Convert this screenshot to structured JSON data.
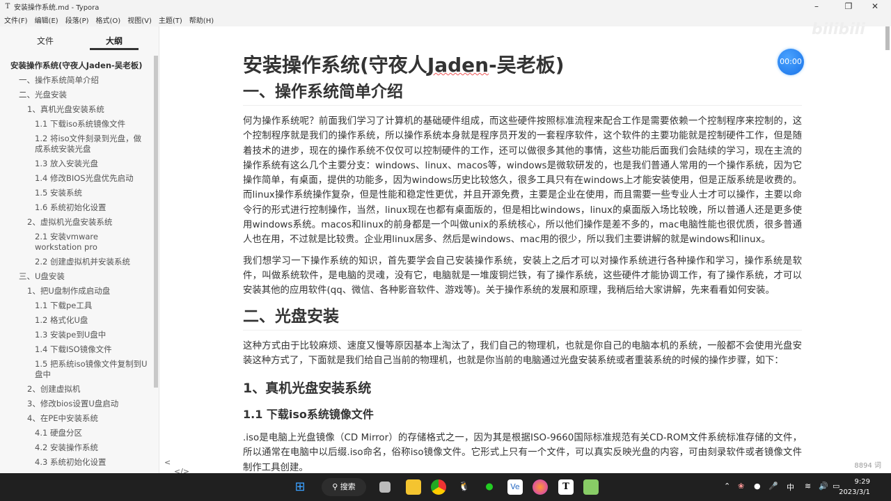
{
  "window": {
    "title": "安装操作系统.md - Typora",
    "app_icon": "T"
  },
  "menu": [
    "文件(F)",
    "编辑(E)",
    "段落(P)",
    "格式(O)",
    "视图(V)",
    "主题(T)",
    "帮助(H)"
  ],
  "sidebar": {
    "tabs": [
      "文件",
      "大纲"
    ],
    "active_tab": "大纲",
    "outline": [
      {
        "level": 0,
        "text": "安装操作系统(守夜人Jaden-吴老板)"
      },
      {
        "level": 1,
        "text": "一、操作系统简单介绍"
      },
      {
        "level": 1,
        "text": "二、光盘安装"
      },
      {
        "level": 2,
        "text": "1、真机光盘安装系统"
      },
      {
        "level": 3,
        "text": "1.1 下载iso系统镜像文件"
      },
      {
        "level": 3,
        "text": "1.2 将iso文件刻录到光盘，做成系统安装光盘"
      },
      {
        "level": 3,
        "text": "1.3 放入安装光盘"
      },
      {
        "level": 3,
        "text": "1.4 修改BIOS光盘优先启动"
      },
      {
        "level": 3,
        "text": "1.5 安装系统"
      },
      {
        "level": 3,
        "text": "1.6 系统初始化设置"
      },
      {
        "level": 2,
        "text": "2、虚拟机光盘安装系统"
      },
      {
        "level": 3,
        "text": "2.1 安装vmware workstation pro"
      },
      {
        "level": 3,
        "text": "2.2 创建虚拟机并安装系统"
      },
      {
        "level": 1,
        "text": "三、U盘安装"
      },
      {
        "level": 2,
        "text": "1、把U盘制作成启动盘"
      },
      {
        "level": 3,
        "text": "1.1 下载pe工具"
      },
      {
        "level": 3,
        "text": "1.2 格式化U盘"
      },
      {
        "level": 3,
        "text": "1.3 安装pe到U盘中"
      },
      {
        "level": 3,
        "text": "1.4 下载ISO镜像文件"
      },
      {
        "level": 3,
        "text": "1.5 把系统iso镜像文件复制到U盘中"
      },
      {
        "level": 2,
        "text": "2、创建虚拟机"
      },
      {
        "level": 2,
        "text": "3、修改bios设置U盘启动"
      },
      {
        "level": 2,
        "text": "4、在PE中安装系统"
      },
      {
        "level": 3,
        "text": "4.1 硬盘分区"
      },
      {
        "level": 3,
        "text": "4.2 安装操作系统"
      },
      {
        "level": 3,
        "text": "4.3 系统初始化设置"
      }
    ],
    "footer": {
      "back": "<",
      "source": "</>"
    }
  },
  "doc": {
    "h1_pre": "安装操作系统(守夜人",
    "h1_ul": "Jaden",
    "h1_post": "-吴老板)",
    "h2_1": "一、操作系统简单介绍",
    "p1": "何为操作系统呢？前面我们学习了计算机的基础硬件组成，而这些硬件按照标准流程来配合工作是需要依赖一个控制程序来控制的，这个控制程序就是我们的操作系统，所以操作系统本身就是程序员开发的一套程序软件，这个软件的主要功能就是控制硬件工作，但是随着技术的进步，现在的操作系统不仅仅可以控制硬件的工作，还可以做很多其他的事情，这些功能后面我们会陆续的学习，现在主流的操作系统有这么几个主要分支：windows、linux、macos等，windows是微软研发的，也是我们普通人常用的一个操作系统，因为它操作简单，有桌面，提供的功能多，因为windows历史比较悠久，很多工具只有在windows上才能安装使用，但是正版系统是收费的。而linux操作系统操作复杂，但是性能和稳定性更优，并且开源免费，主要是企业在使用，而且需要一些专业人士才可以操作，主要以命令行的形式进行控制操作，当然，linux现在也都有桌面版的，但是相比windows，linux的桌面版入场比较晚，所以普通人还是更多使用windows系统。macos和linux的前身都是一个叫做unix的系统核心，所以他们操作是差不多的，mac电脑性能也很优质，很多普通人也在用，不过就是比较贵。企业用linux居多、然后是windows、mac用的很少，所以我们主要讲解的就是windows和linux。",
    "p2": "我们想学习一下操作系统的知识，首先要学会自己安装操作系统，安装上之后才可以对操作系统进行各种操作和学习，操作系统是软件，叫做系统软件，是电脑的灵魂，没有它，电脑就是一堆废铜烂铁，有了操作系统，这些硬件才能协调工作，有了操作系统，才可以安装其他的应用软件(qq、微信、各种影音软件、游戏等)。关于操作系统的发展和原理，我稍后给大家讲解，先来看看如何安装。",
    "h2_2": "二、光盘安装",
    "p3": "这种方式由于比较麻烦、速度又慢等原因基本上淘汰了，我们自己的物理机，也就是你自己的电脑本机的系统，一般都不会使用光盘安装这种方式了，下面就是我们给自己当前的物理机，也就是你当前的电脑通过光盘安装系统或者重装系统的时候的操作步骤，如下：",
    "h3_1": "1、真机光盘安装系统",
    "h4_1": "1.1 下载iso系统镜像文件",
    "p4": ".iso是电脑上光盘镜像（CD Mirror）的存储格式之一，因为其是根据ISO-9660国际标准规范有关CD-ROM文件系统标准存储的文件，所以通常在电脑中以后缀.iso命名，俗称iso镜像文件。它形式上只有一个文件，可以真实反映光盘的内容，可由刻录软件或者镜像文件制作工具创建。"
  },
  "timer": "00:00",
  "word_count": "8894 词",
  "taskbar": {
    "search": "搜索",
    "ime": "中",
    "time": "9:29",
    "date": "2023/3/1"
  }
}
